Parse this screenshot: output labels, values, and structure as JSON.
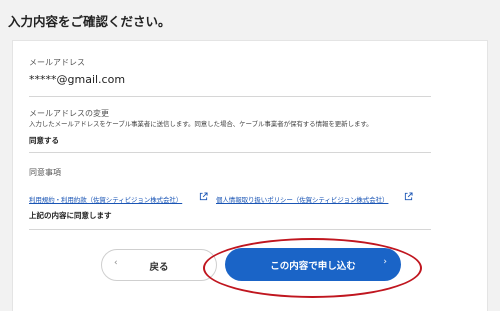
{
  "page": {
    "title": "入力内容をご確認ください。"
  },
  "email_section": {
    "label": "メールアドレス",
    "value": "*****@gmail.com"
  },
  "email_change_section": {
    "label": "メールアドレスの変更",
    "description": "入力したメールアドレスをケーブル事業者に送信します。同意した場合、ケーブル事業者が保有する情報を更新します。",
    "value": "同意する"
  },
  "agreement_section": {
    "label": "同意事項",
    "links": [
      {
        "label": "利用規約・利用約款（佐賀シティビジョン株式会社）",
        "icon": "external-link-icon"
      },
      {
        "label": "個人情報取り扱いポリシー（佐賀シティビジョン株式会社）",
        "icon": "external-link-icon"
      }
    ],
    "confirm_text": "上記の内容に同意します"
  },
  "actions": {
    "back_label": "戻る",
    "back_icon": "chevron-left-icon",
    "submit_label": "この内容で申し込む",
    "submit_icon": "chevron-right-icon",
    "submit_color": "#1a64c7",
    "highlight_color": "#c0161f"
  }
}
